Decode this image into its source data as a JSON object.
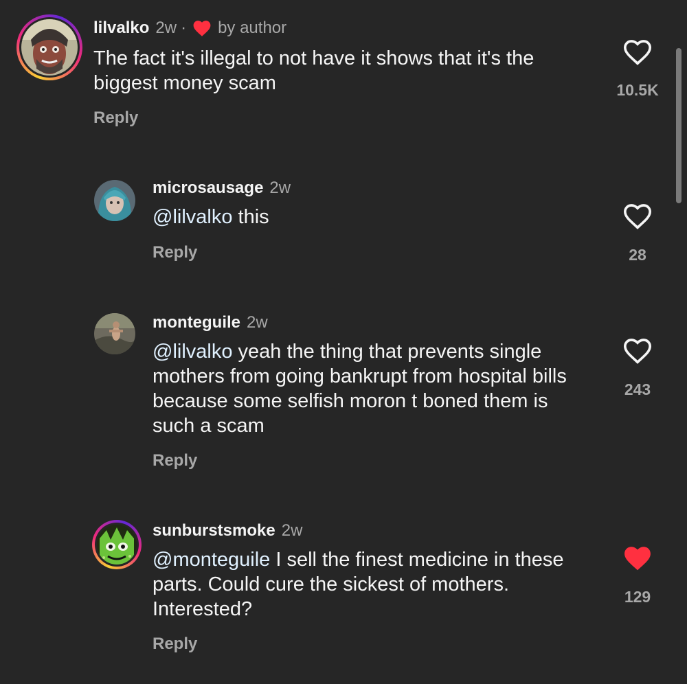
{
  "comments": [
    {
      "username": "lilvalko",
      "time": "2w",
      "separator": "·",
      "author_badge": "by author",
      "mention": "",
      "text": "The fact it's illegal to not have it shows that it's the biggest money scam",
      "reply_label": "Reply",
      "likes": "10.5K",
      "liked": false,
      "has_story_ring": true,
      "avatar_icon": "person-portrait"
    },
    {
      "username": "microsausage",
      "time": "2w",
      "mention": "@lilvalko",
      "text": " this",
      "reply_label": "Reply",
      "likes": "28",
      "liked": false,
      "has_story_ring": false,
      "avatar_icon": "person-portrait"
    },
    {
      "username": "monteguile",
      "time": "2w",
      "mention": "@lilvalko",
      "text": " yeah the thing that prevents single mothers from going bankrupt from hospital bills because some selfish moron t boned them is such a scam",
      "reply_label": "Reply",
      "likes": "243",
      "liked": false,
      "has_story_ring": false,
      "avatar_icon": "person-outdoors"
    },
    {
      "username": "sunburstsmoke",
      "time": "2w",
      "mention": "@monteguile",
      "text": " I sell the finest medicine in these parts. Could cure the sickest of mothers. Interested?",
      "reply_label": "Reply",
      "likes": "129",
      "liked": true,
      "has_story_ring": true,
      "avatar_icon": "green-creature"
    }
  ],
  "colors": {
    "background": "#262626",
    "text_primary": "#f5f5f5",
    "text_secondary": "#a8a8a8",
    "like_red": "#ff3040"
  }
}
